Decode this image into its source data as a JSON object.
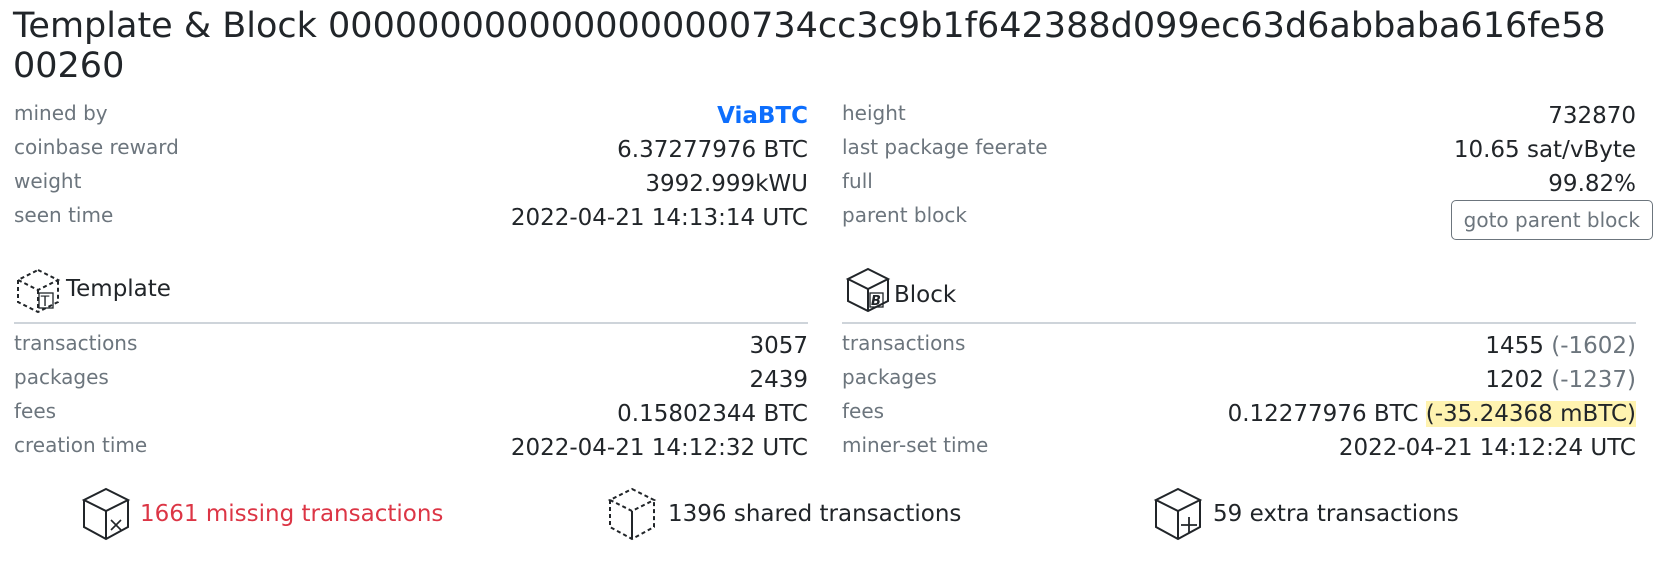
{
  "header": {
    "title": "Template & Block 0000000000000000000734cc3c9b1f642388d099ec63d6abbaba616fe5800260"
  },
  "overview": {
    "left": [
      {
        "label": "mined by",
        "value": "ViaBTC"
      },
      {
        "label": "coinbase reward",
        "value": "6.37277976 BTC"
      },
      {
        "label": "weight",
        "value": "3992.999kWU"
      },
      {
        "label": "seen time",
        "value": "2022-04-21 14:13:14 UTC"
      }
    ],
    "right": [
      {
        "label": "height",
        "value": "732870"
      },
      {
        "label": "last package feerate",
        "value": "10.65 sat/vByte"
      },
      {
        "label": "full",
        "value": "99.82%"
      },
      {
        "label": "parent block",
        "button": "goto parent block"
      }
    ]
  },
  "template": {
    "title": "Template",
    "icon": "box-t-icon",
    "rows": [
      {
        "label": "transactions",
        "value": "3057"
      },
      {
        "label": "packages",
        "value": "2439"
      },
      {
        "label": "fees",
        "value": "0.15802344 BTC"
      },
      {
        "label": "creation time",
        "value": "2022-04-21 14:12:32 UTC"
      }
    ]
  },
  "block": {
    "title": "Block",
    "icon": "box-b-icon",
    "rows": [
      {
        "label": "transactions",
        "value": "1455",
        "diff": "(-1602)"
      },
      {
        "label": "packages",
        "value": "1202",
        "diff": "(-1237)"
      },
      {
        "label": "fees",
        "value": "0.12277976 BTC",
        "diff": "(-35.24368 mBTC)"
      },
      {
        "label": "miner-set time",
        "value": "2022-04-21 14:12:24 UTC"
      }
    ]
  },
  "stats": {
    "missing": "1661 missing transactions",
    "shared": "1396 shared transactions",
    "extra": "59 extra transactions"
  },
  "colors": {
    "link": "#0d6efd",
    "missing": "#dc3545",
    "highlight": "#fff3b0",
    "muted": "#6c757d"
  }
}
